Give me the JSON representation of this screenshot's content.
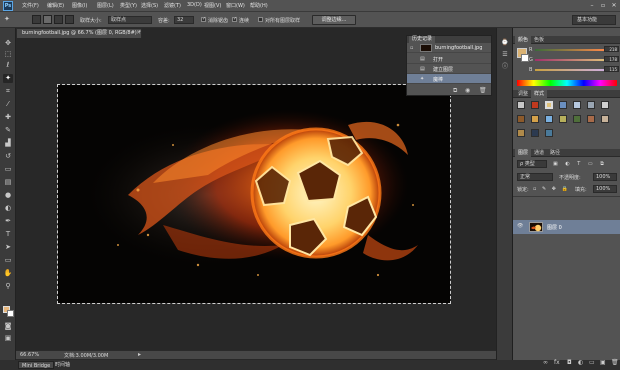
{
  "menubar": {
    "logo": "Ps",
    "items": [
      "文件(F)",
      "编辑(E)",
      "图像(I)",
      "图层(L)",
      "类型(Y)",
      "选择(S)",
      "滤镜(T)",
      "3D(D)",
      "视图(V)",
      "窗口(W)",
      "帮助(H)"
    ],
    "window_buttons": [
      "–",
      "▫",
      "✕"
    ]
  },
  "options": {
    "sample_size_label": "取样大小:",
    "sample_size_value": "取样点",
    "tolerance_label": "容差:",
    "tolerance_value": "32",
    "antialias_label": "消除锯齿",
    "contiguous_label": "连续",
    "sample_all_label": "对所有图层取样",
    "refine_edge_label": "调整边缘...",
    "workspace_label": "基本功能"
  },
  "document": {
    "tab_label": "burningfootball.jpg @ 66.7% (图层 0, RGB/8#) *",
    "close": "×",
    "status_zoom": "66.67%",
    "status_doc": "文档:3.00M/3.00M",
    "status_arrow": "▸"
  },
  "bottom_tabs": [
    "Mini Bridge",
    "时间轴"
  ],
  "history": {
    "tab_label": "历史记录",
    "snapshot_label": "burningfootball.jpg",
    "steps": [
      "打开",
      "建立图层",
      "魔棒"
    ]
  },
  "color_panel": {
    "tabs": [
      "颜色",
      "色板"
    ],
    "r_label": "R",
    "r_value": "218",
    "g_label": "G",
    "g_value": "178",
    "b_label": "B",
    "b_value": "115",
    "fg_color": "#dab273"
  },
  "styles_panel": {
    "tabs": [
      "调整",
      "样式"
    ]
  },
  "layers_panel": {
    "tabs": [
      "图层",
      "通道",
      "路径"
    ],
    "kind_label": "ρ 类型",
    "blend_mode": "正常",
    "opacity_label": "不透明度:",
    "opacity_value": "100%",
    "lock_label": "锁定:",
    "fill_label": "填充:",
    "fill_value": "100%",
    "layer_name": "图层 0"
  }
}
